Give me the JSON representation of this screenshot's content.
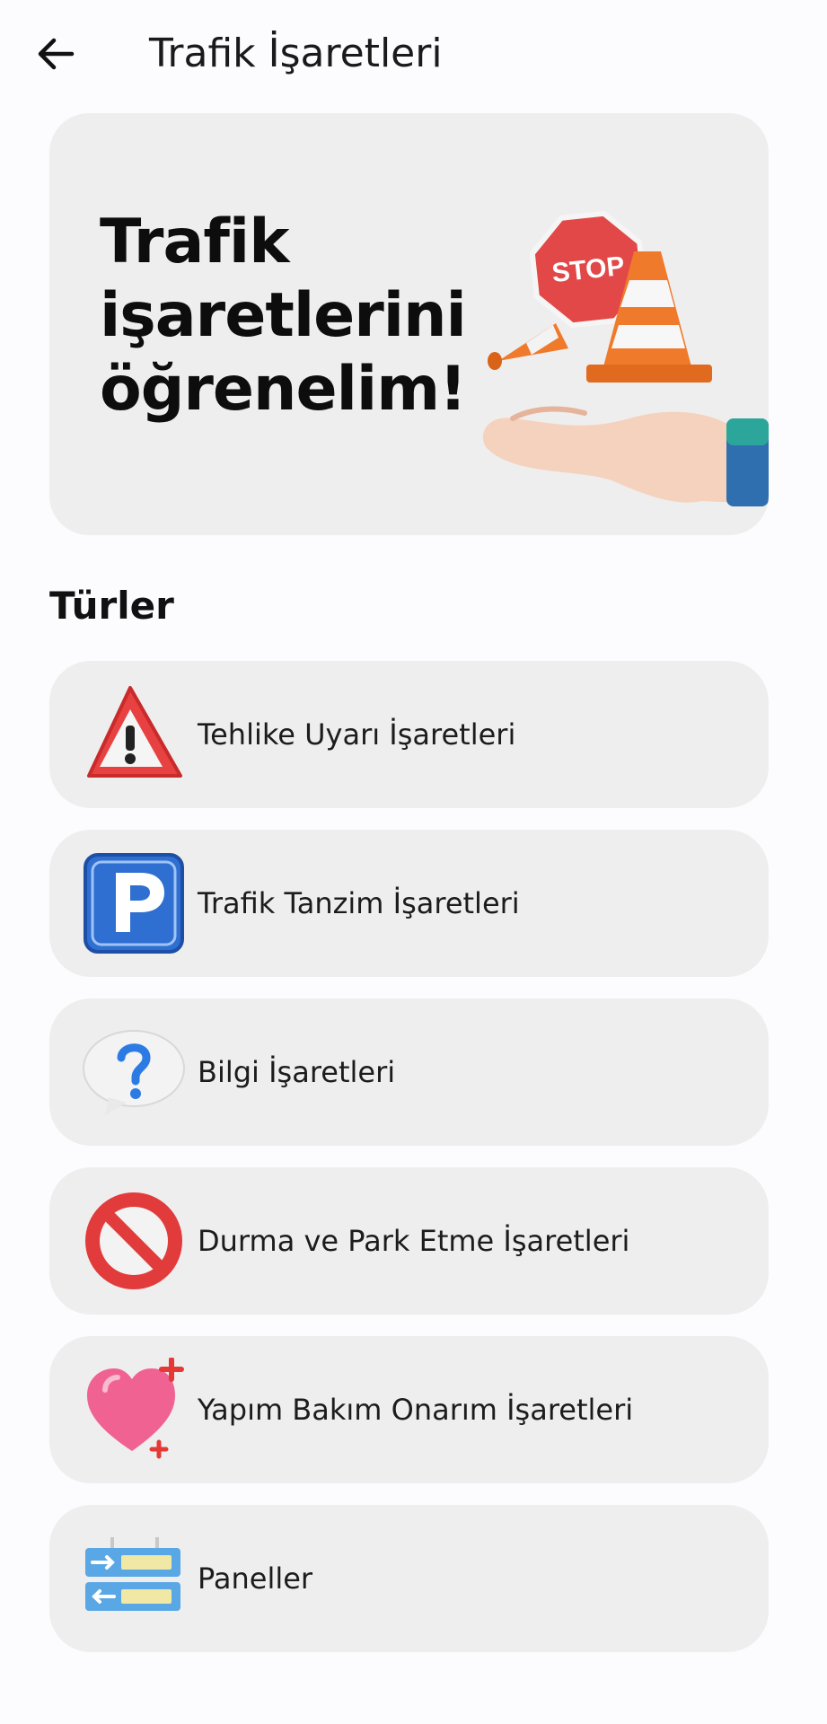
{
  "header": {
    "title": "Trafik İşaretleri",
    "back_icon": "arrow-left-icon"
  },
  "banner": {
    "lines": [
      "Trafik",
      "işaretlerini",
      "öğrenelim!"
    ],
    "illustration": "hand-holding-stop-sign-and-cones",
    "stop_text": "STOP"
  },
  "section": {
    "title": "Türler"
  },
  "categories": [
    {
      "label": "Tehlike Uyarı İşaretleri",
      "icon": "warning-triangle-icon"
    },
    {
      "label": "Trafik Tanzim İşaretleri",
      "icon": "parking-sign-icon"
    },
    {
      "label": "Bilgi İşaretleri",
      "icon": "question-bubble-icon"
    },
    {
      "label": "Durma ve Park Etme İşaretleri",
      "icon": "no-entry-icon"
    },
    {
      "label": "Yapım Bakım Onarım İşaretleri",
      "icon": "heart-plus-icon"
    },
    {
      "label": "Paneller",
      "icon": "panel-signs-icon"
    }
  ],
  "colors": {
    "background": "#fcfcfe",
    "card": "#efeeee",
    "warning_red": "#e53a3a",
    "parking_blue": "#2f6fd1",
    "info_blue": "#2c7be5",
    "heart_pink": "#f06292",
    "panel_blue": "#5aa7e6"
  }
}
